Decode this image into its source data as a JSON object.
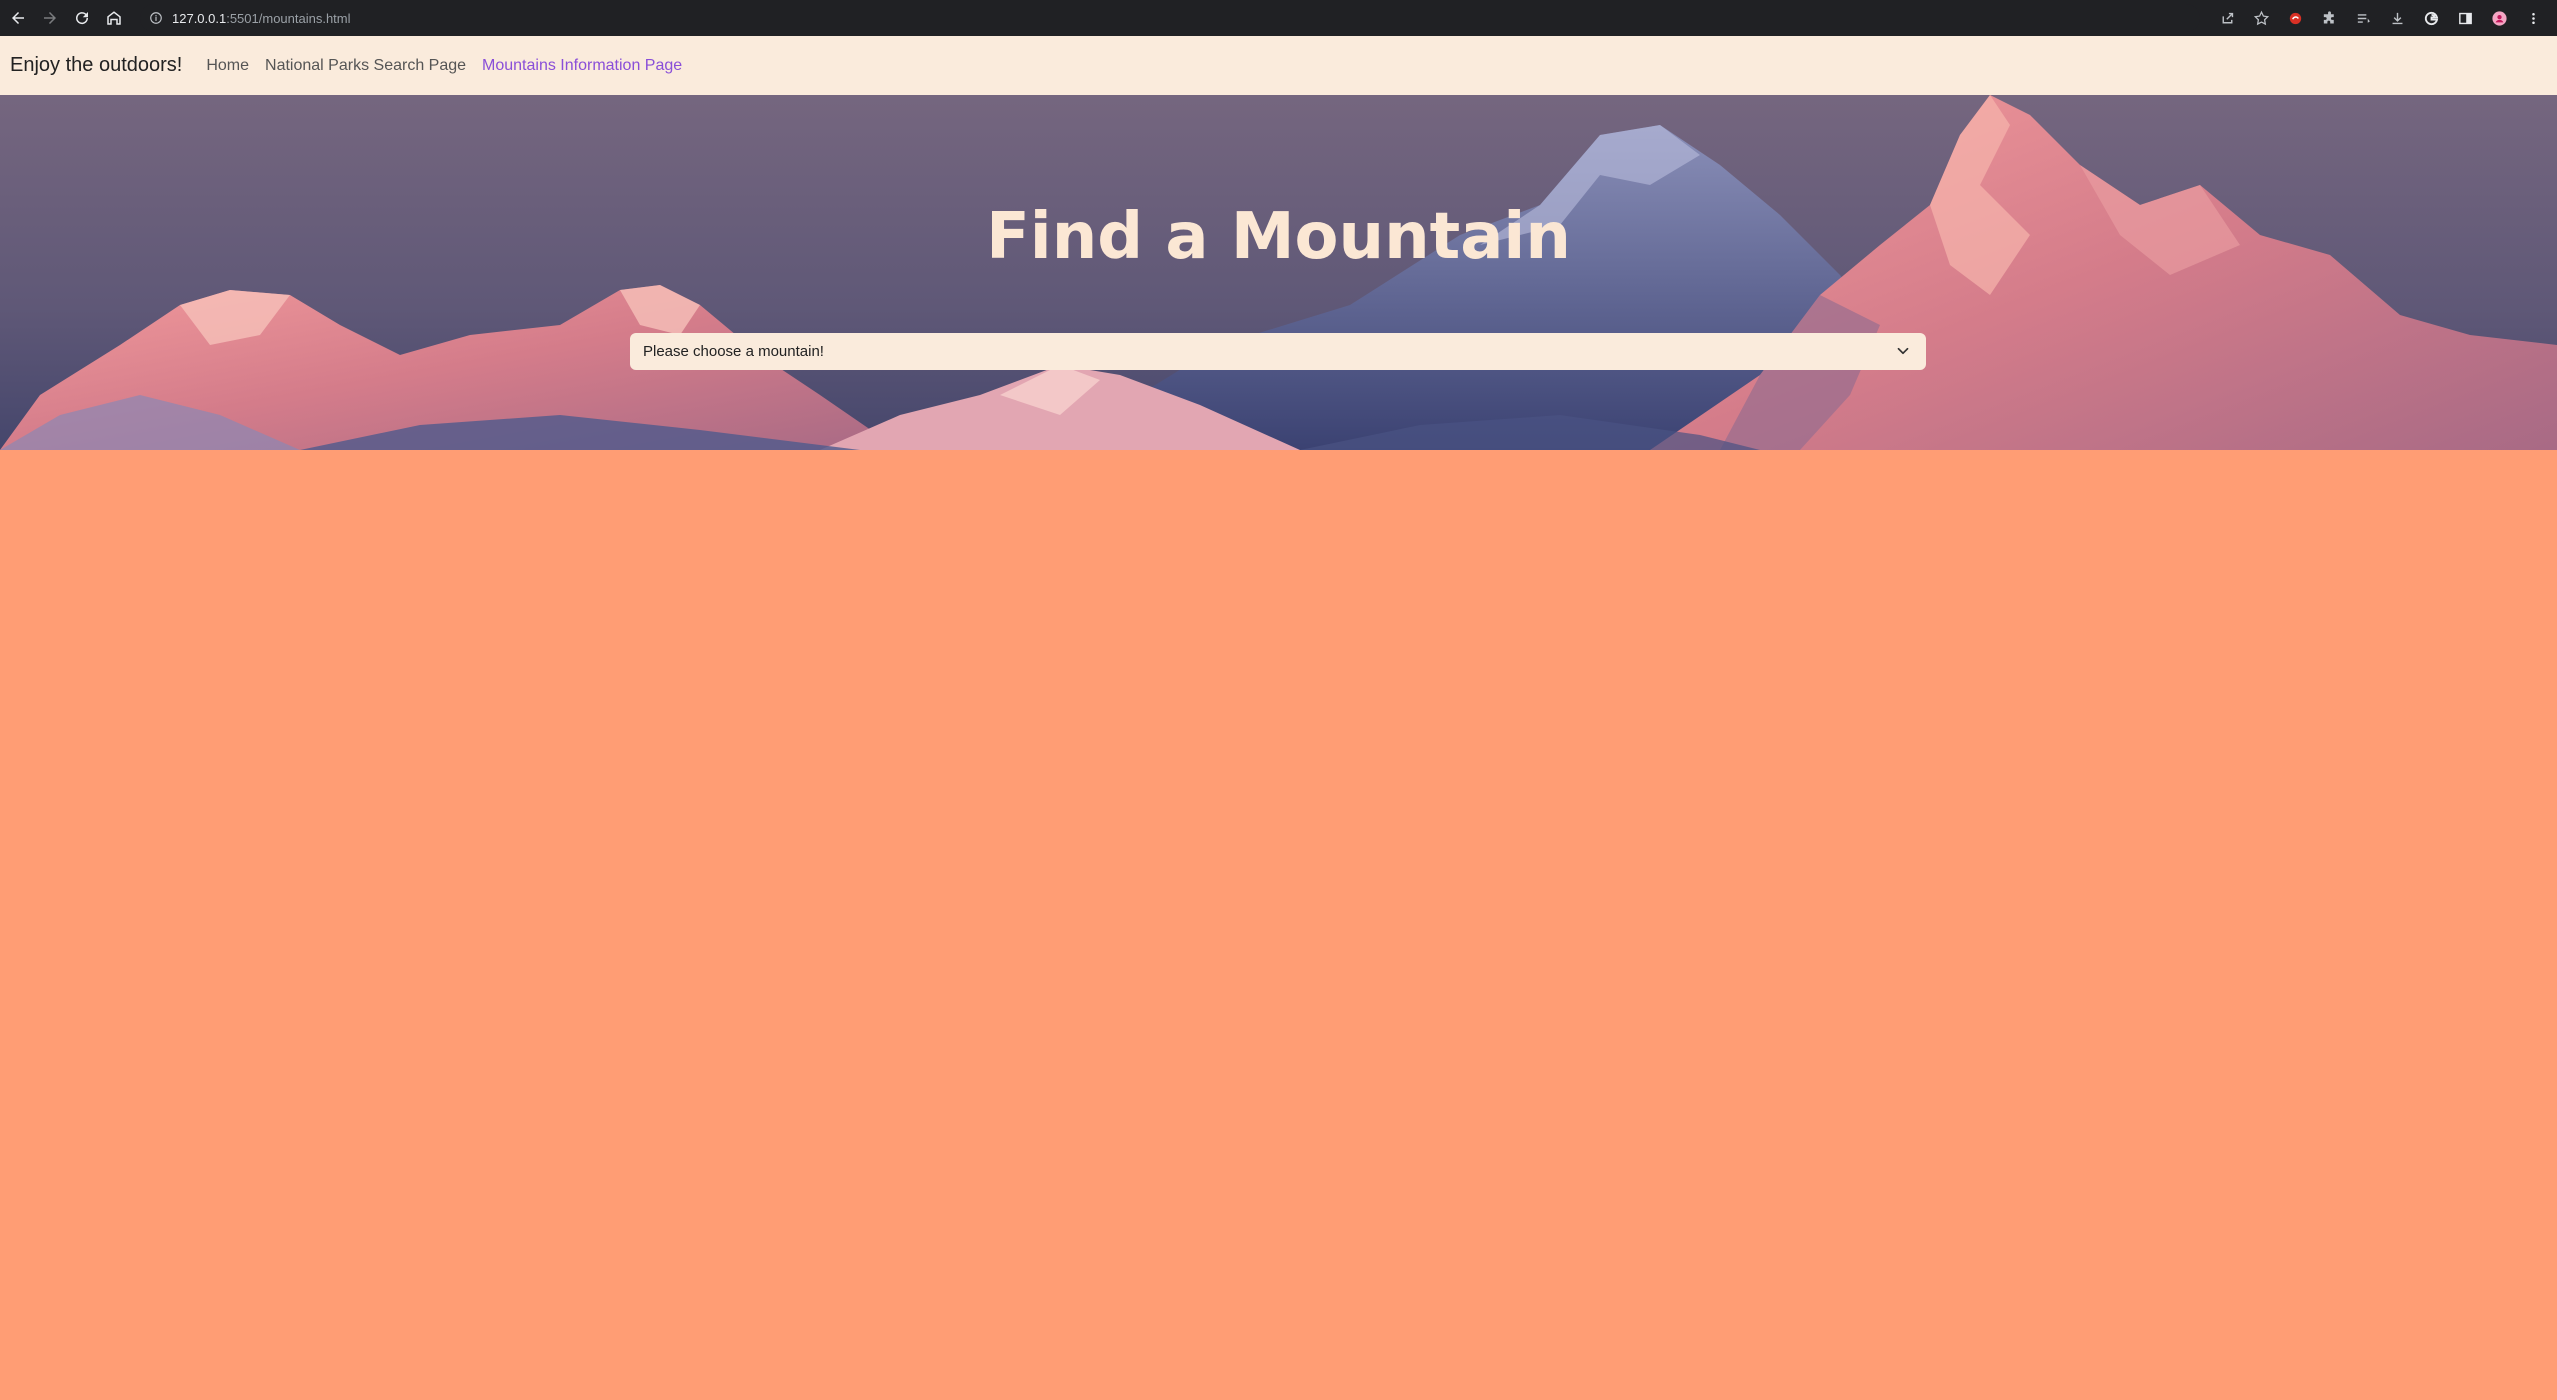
{
  "browser": {
    "url_host": "127.0.0.1",
    "url_rest": ":5501/mountains.html",
    "icons": [
      "back-icon",
      "forward-icon",
      "reload-icon",
      "home-icon",
      "info-icon",
      "share-icon",
      "bookmark-star-icon",
      "extension-red-icon",
      "extensions-puzzle-icon",
      "reading-list-icon",
      "download-icon",
      "google-icon",
      "side-panel-icon",
      "profile-avatar-icon",
      "menu-kebab-icon"
    ]
  },
  "navbar": {
    "brand": "Enjoy the outdoors!",
    "links": [
      {
        "label": "Home",
        "active": false
      },
      {
        "label": "National Parks Search Page",
        "active": false
      },
      {
        "label": "Mountains Information Page",
        "active": true
      }
    ]
  },
  "hero": {
    "title": "Find a Mountain",
    "select": {
      "selected": "Please choose a mountain!"
    }
  },
  "colors": {
    "page_background": "#ff9d74",
    "navbar_background": "#faebdc",
    "active_link": "#8a4fd8",
    "title_color": "#fbe7d4",
    "chrome_background": "#202124"
  }
}
